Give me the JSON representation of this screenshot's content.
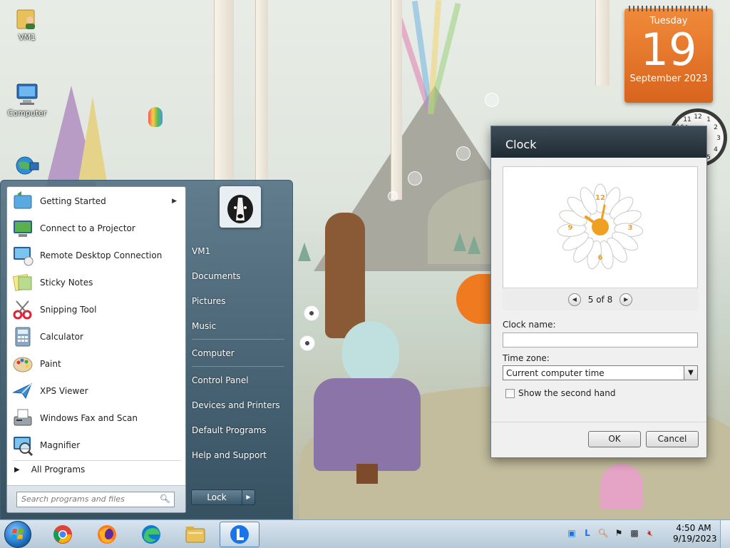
{
  "desktop": {
    "icons": [
      {
        "label": "VM1"
      },
      {
        "label": "Computer"
      }
    ]
  },
  "calendar_gadget": {
    "weekday": "Tuesday",
    "day": "19",
    "month_year": "September 2023"
  },
  "clock_dialog": {
    "title": "Clock",
    "pager_text": "5 of 8",
    "clock_name_label": "Clock name:",
    "clock_name_value": "",
    "time_zone_label": "Time zone:",
    "time_zone_value": "Current computer time",
    "second_hand_label": "Show the second hand",
    "second_hand_checked": false,
    "ok_label": "OK",
    "cancel_label": "Cancel",
    "accent_color": "#f0a020"
  },
  "start_menu": {
    "programs": [
      {
        "label": "Getting Started",
        "icon": "getting-started-icon",
        "has_submenu": true
      },
      {
        "label": "Connect to a Projector",
        "icon": "projector-icon",
        "has_submenu": false
      },
      {
        "label": "Remote Desktop Connection",
        "icon": "remote-desktop-icon",
        "has_submenu": false
      },
      {
        "label": "Sticky Notes",
        "icon": "sticky-notes-icon",
        "has_submenu": false
      },
      {
        "label": "Snipping Tool",
        "icon": "scissors-icon",
        "has_submenu": false
      },
      {
        "label": "Calculator",
        "icon": "calculator-icon",
        "has_submenu": false
      },
      {
        "label": "Paint",
        "icon": "paint-palette-icon",
        "has_submenu": false
      },
      {
        "label": "XPS Viewer",
        "icon": "xps-viewer-icon",
        "has_submenu": false
      },
      {
        "label": "Windows Fax and Scan",
        "icon": "fax-icon",
        "has_submenu": false
      },
      {
        "label": "Magnifier",
        "icon": "magnifier-icon",
        "has_submenu": false
      }
    ],
    "all_programs_label": "All Programs",
    "search_placeholder": "Search programs and files",
    "right_items": {
      "user": "VM1",
      "documents": "Documents",
      "pictures": "Pictures",
      "music": "Music",
      "computer": "Computer",
      "control_panel": "Control Panel",
      "devices_printers": "Devices and Printers",
      "default_programs": "Default Programs",
      "help_support": "Help and Support"
    },
    "lock_label": "Lock"
  },
  "taskbar": {
    "pinned": [
      "chrome-icon",
      "firefox-icon",
      "edge-icon",
      "file-explorer-icon",
      "app-l-icon"
    ],
    "time": "4:50 AM",
    "date": "9/19/2023",
    "start_orb_color": "#1f6fc0"
  }
}
